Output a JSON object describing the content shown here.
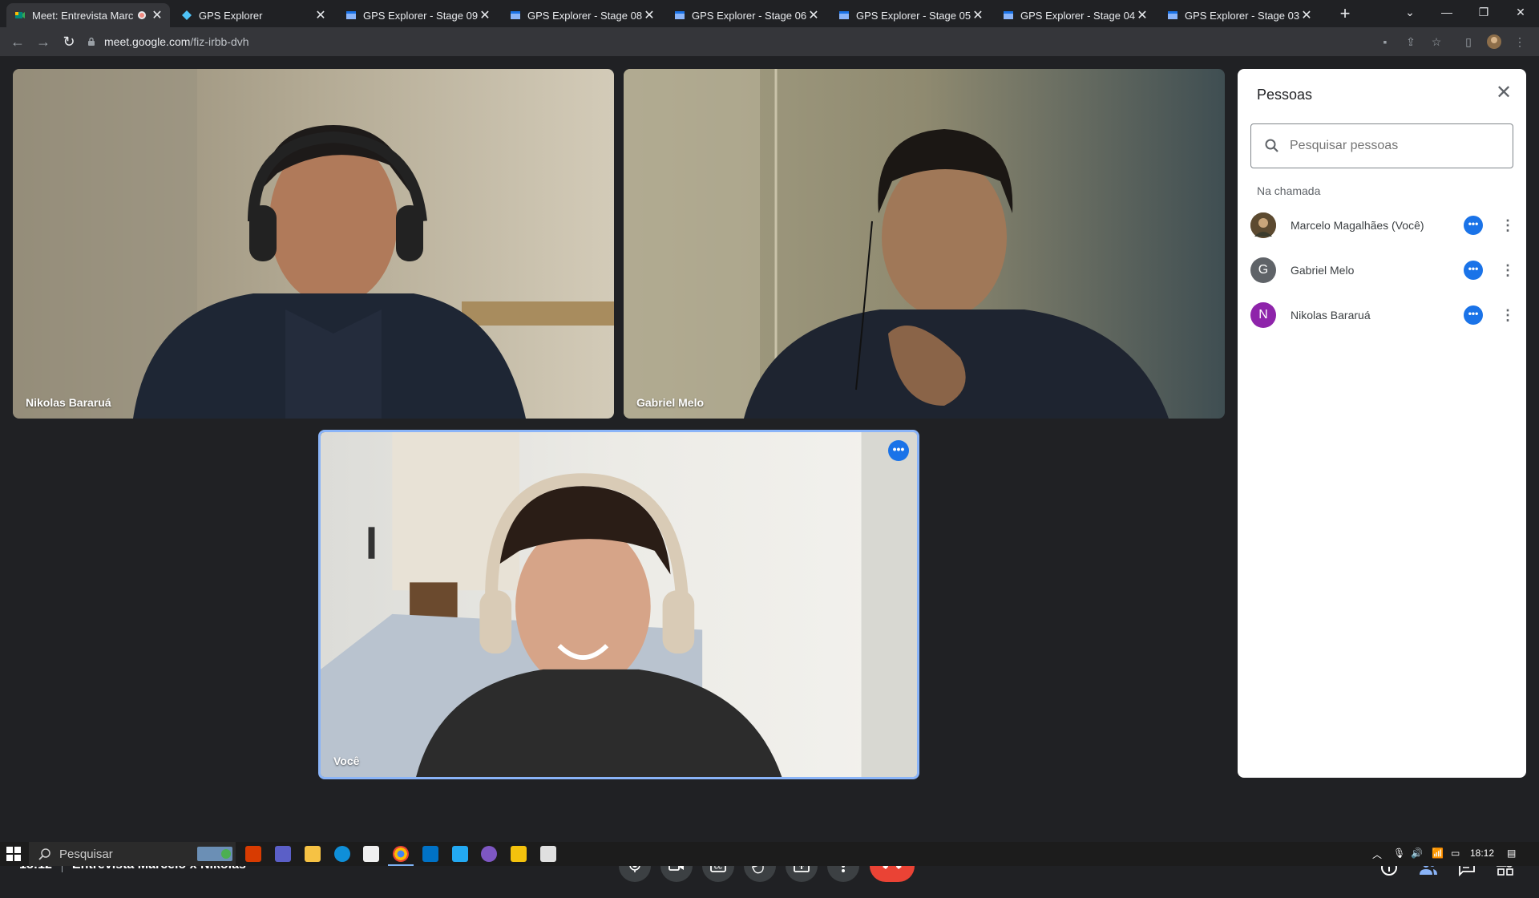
{
  "browser": {
    "tabs": [
      {
        "title": "Meet: Entrevista Marce",
        "active": true
      },
      {
        "title": "GPS Explorer"
      },
      {
        "title": "GPS Explorer - Stage 09"
      },
      {
        "title": "GPS Explorer - Stage 08"
      },
      {
        "title": "GPS Explorer - Stage 06"
      },
      {
        "title": "GPS Explorer - Stage 05"
      },
      {
        "title": "GPS Explorer - Stage 04"
      },
      {
        "title": "GPS Explorer - Stage 03"
      }
    ],
    "url_host": "meet.google.com",
    "url_path": "/fiz-irbb-dvh"
  },
  "meeting": {
    "time": "18:12",
    "title": "Entrevista Marcelo x Nikolas",
    "participant_count": "3",
    "tiles": [
      {
        "name": "Nikolas Bararuá"
      },
      {
        "name": "Gabriel Melo"
      },
      {
        "name": "Você"
      }
    ]
  },
  "people_panel": {
    "title": "Pessoas",
    "search_placeholder": "Pesquisar pessoas",
    "section": "Na chamada",
    "people": [
      {
        "name": "Marcelo Magalhães (Você)",
        "initial": "",
        "avatar_color": "#6d5a3a"
      },
      {
        "name": "Gabriel Melo",
        "initial": "G",
        "avatar_color": "#5f6368"
      },
      {
        "name": "Nikolas Bararuá",
        "initial": "N",
        "avatar_color": "#8e24aa"
      }
    ]
  },
  "taskbar": {
    "search_placeholder": "Pesquisar",
    "clock": "18:12"
  },
  "colors": {
    "accent": "#1a73e8",
    "end_call": "#ea4335",
    "background": "#202124"
  }
}
